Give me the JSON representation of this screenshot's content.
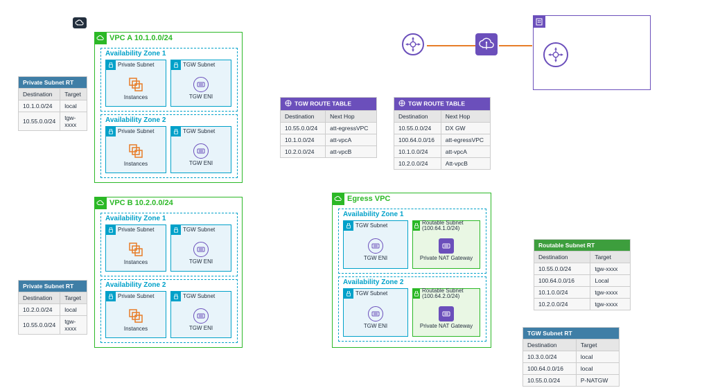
{
  "cloud_icon": "aws-cloud-icon",
  "vpc_a": {
    "title": "VPC A 10.1.0.0/24",
    "az1": {
      "label": "Availability Zone 1",
      "priv": "Private Subnet",
      "tgw": "TGW Subnet",
      "inst": "Instances",
      "eni": "TGW ENI"
    },
    "az2": {
      "label": "Availability Zone 2",
      "priv": "Private Subnet",
      "tgw": "TGW Subnet",
      "inst": "Instances",
      "eni": "TGW ENI"
    }
  },
  "vpc_b": {
    "title": "VPC B 10.2.0.0/24",
    "az1": {
      "label": "Availability Zone 1",
      "priv": "Private Subnet",
      "tgw": "TGW Subnet",
      "inst": "Instances",
      "eni": "TGW ENI"
    },
    "az2": {
      "label": "Availability Zone 2",
      "priv": "Private Subnet",
      "tgw": "TGW Subnet",
      "inst": "Instances",
      "eni": "TGW ENI"
    }
  },
  "egress": {
    "title": "Egress VPC",
    "az1": {
      "label": "Availability Zone 1",
      "tgw": "TGW Subnet",
      "tgweni": "TGW ENI",
      "rsub": "Routable Subnet (100.64.1.0/24)",
      "pnat": "Private NAT Gateway"
    },
    "az2": {
      "label": "Availability Zone 2",
      "tgw": "TGW Subnet",
      "tgweni": "TGW ENI",
      "rsub": "Routable Subnet (100.64.2.0/24)",
      "pnat": "Private NAT Gateway"
    }
  },
  "rt_a": {
    "title": "Private Subnet RT",
    "cols": [
      "Destination",
      "Target"
    ],
    "rows": [
      [
        "10.1.0.0/24",
        "local"
      ],
      [
        "10.55.0.0/24",
        "tgw-xxxx"
      ]
    ]
  },
  "rt_b": {
    "title": "Private Subnet RT",
    "cols": [
      "Destination",
      "Target"
    ],
    "rows": [
      [
        "10.2.0.0/24",
        "local"
      ],
      [
        "10.55.0.0/24",
        "tgw-xxxx"
      ]
    ]
  },
  "rt_tgw1": {
    "title": "TGW ROUTE TABLE",
    "cols": [
      "Destination",
      "Next Hop"
    ],
    "rows": [
      [
        "10.55.0.0/24",
        "att-egressVPC"
      ],
      [
        "10.1.0.0/24",
        "att-vpcA"
      ],
      [
        "10.2.0.0/24",
        "att-vpcB"
      ]
    ]
  },
  "rt_tgw2": {
    "title": "TGW ROUTE TABLE",
    "cols": [
      "Destination",
      "Next Hop"
    ],
    "rows": [
      [
        "10.55.0.0/24",
        "DX GW"
      ],
      [
        "100.64.0.0/16",
        "att-egressVPC"
      ],
      [
        "10.1.0.0/24",
        "att-vpcA"
      ],
      [
        "10.2.0.0/24",
        "Att-vpcB"
      ]
    ]
  },
  "rt_routable": {
    "title": "Routable Subnet RT",
    "cols": [
      "Destination",
      "Target"
    ],
    "rows": [
      [
        "10.55.0.0/24",
        "tgw-xxxx"
      ],
      [
        "100.64.0.0/16",
        "Local"
      ],
      [
        "10.1.0.0/24",
        "tgw-xxxx"
      ],
      [
        "10.2.0.0/24",
        "tgw-xxxx"
      ]
    ]
  },
  "rt_tgwsub": {
    "title": "TGW Subnet RT",
    "cols": [
      "Destination",
      "Target"
    ],
    "rows": [
      [
        "10.3.0.0/24",
        "local"
      ],
      [
        "100.64.0.0/16",
        "local"
      ],
      [
        "10.55.0.0/24",
        "P-NATGW"
      ]
    ]
  },
  "corp": {
    "title": ""
  }
}
